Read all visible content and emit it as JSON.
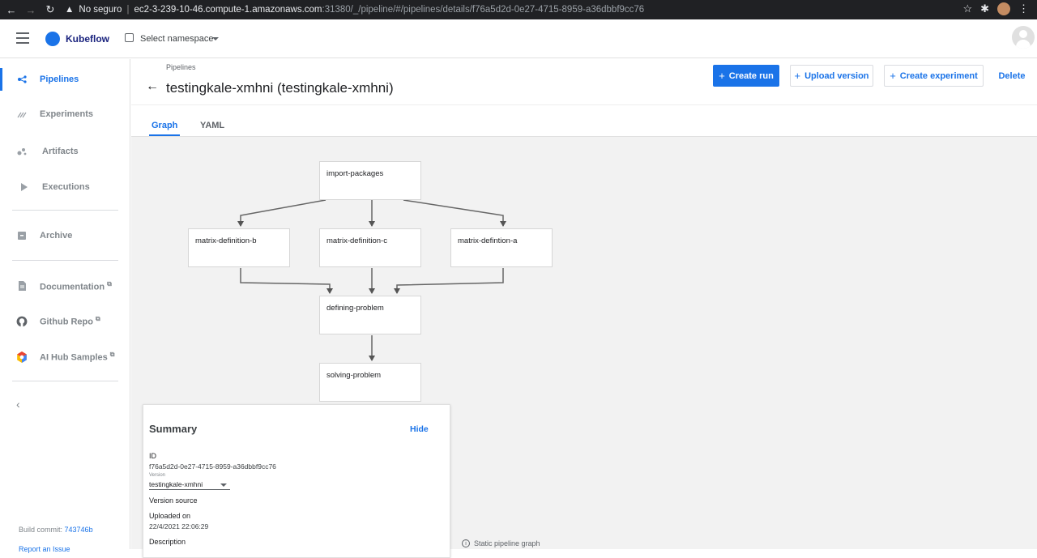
{
  "browser": {
    "warning": "No seguro",
    "url_host": "ec2-3-239-10-46.compute-1.amazonaws.com",
    "url_path": ":31380/_/pipeline/#/pipelines/details/f76a5d2d-0e27-4715-8959-a36dbbf9cc76"
  },
  "header": {
    "brand": "Kubeflow",
    "namespace_label": "Select namespace"
  },
  "sidebar": {
    "items": [
      {
        "label": "Pipelines",
        "icon": "pipelines-icon",
        "active": true
      },
      {
        "label": "Experiments",
        "icon": "experiments-icon"
      },
      {
        "label": "Artifacts",
        "icon": "artifacts-icon"
      },
      {
        "label": "Executions",
        "icon": "executions-icon"
      },
      {
        "label": "Archive",
        "icon": "archive-icon"
      },
      {
        "label": "Documentation",
        "icon": "document-icon"
      },
      {
        "label": "Github Repo",
        "icon": "github-icon"
      },
      {
        "label": "AI Hub Samples",
        "icon": "ai-hub-icon"
      }
    ],
    "build_commit_label": "Build commit:",
    "build_commit_hash": "743746b",
    "report_issue": "Report an Issue"
  },
  "page": {
    "breadcrumb": "Pipelines",
    "title": "testingkale-xmhni (testingkale-xmhni)"
  },
  "actions": {
    "create_run": "Create run",
    "upload_version": "Upload version",
    "create_experiment": "Create experiment",
    "delete": "Delete"
  },
  "tabs": [
    {
      "label": "Graph",
      "active": true
    },
    {
      "label": "YAML"
    }
  ],
  "graph": {
    "nodes": {
      "import_packages": "import-packages",
      "matrix_b": "matrix-definition-b",
      "matrix_c": "matrix-definition-c",
      "matrix_a": "matrix-defintion-a",
      "defining": "defining-problem",
      "solving": "solving-problem"
    },
    "static_note": "Static pipeline graph"
  },
  "summary": {
    "title": "Summary",
    "hide": "Hide",
    "id_label": "ID",
    "id_value": "f76a5d2d-0e27-4715-8959-a36dbbf9cc76",
    "version_label": "Version",
    "version_value": "testingkale-xmhni",
    "version_source_label": "Version source",
    "uploaded_on_label": "Uploaded on",
    "uploaded_on_value": "22/4/2021 22:06:29",
    "description_label": "Description"
  },
  "colors": {
    "accent": "#1a73e8",
    "canvas_bg": "#f2f2f2"
  }
}
